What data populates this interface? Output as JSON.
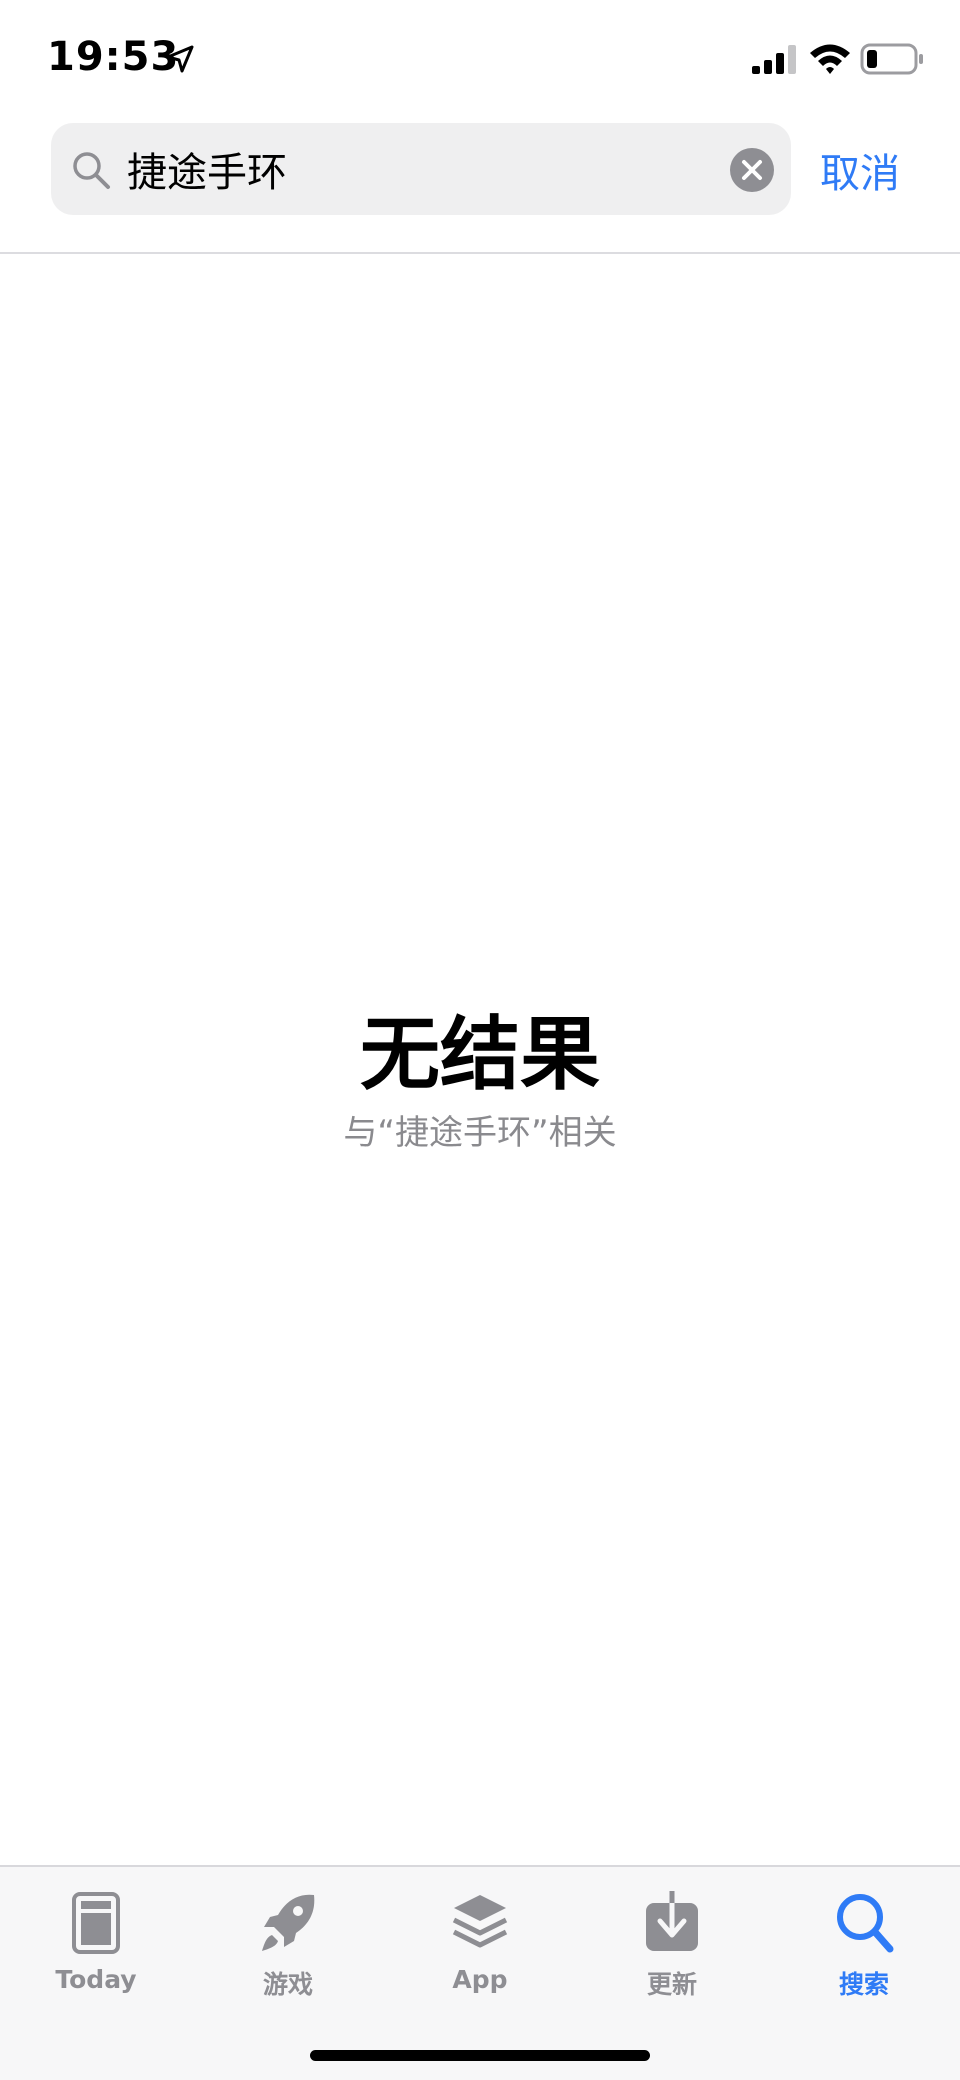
{
  "status_bar": {
    "time": "19:53",
    "location_icon": "location-arrow-icon",
    "signal_icon": "cellular-signal-icon",
    "wifi_icon": "wifi-icon",
    "battery_icon": "battery-icon"
  },
  "search": {
    "query": "捷途手环",
    "cancel_label": "取消",
    "search_icon": "magnifying-glass-icon",
    "clear_icon": "clear-x-icon"
  },
  "results": {
    "title": "无结果",
    "subtitle": "与“捷途手环”相关"
  },
  "tab_bar": {
    "tabs": [
      {
        "label": "Today",
        "icon": "today-card-icon",
        "active": false
      },
      {
        "label": "游戏",
        "icon": "rocket-icon",
        "active": false
      },
      {
        "label": "App",
        "icon": "layers-icon",
        "active": false
      },
      {
        "label": "更新",
        "icon": "download-icon",
        "active": false
      },
      {
        "label": "搜索",
        "icon": "search-icon",
        "active": true
      }
    ]
  },
  "colors": {
    "accent": "#2f7bf6",
    "tab_inactive": "#8e8e93",
    "search_field_bg": "#efeff0"
  }
}
